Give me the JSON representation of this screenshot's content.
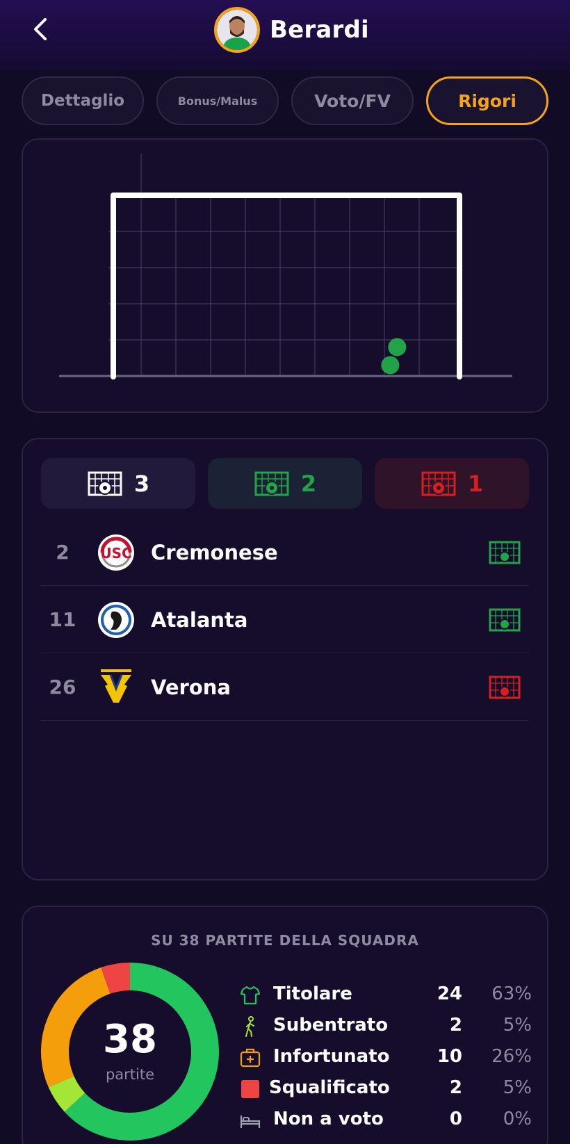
{
  "header": {
    "title": "Berardi"
  },
  "tabs": [
    {
      "label": "Dettaglio",
      "active": false
    },
    {
      "label": "Bonus/Malus",
      "active": false
    },
    {
      "label": "Voto/FV",
      "active": false
    },
    {
      "label": "Rigori",
      "active": true
    }
  ],
  "penalty_map": {
    "shots": [
      {
        "col": 8.2,
        "row": 4.2,
        "result": "goal"
      },
      {
        "col": 8.0,
        "row": 4.7,
        "result": "goal"
      }
    ]
  },
  "summary": {
    "total": "3",
    "scored": "2",
    "missed": "1"
  },
  "penalties": [
    {
      "matchday": "2",
      "team": "Cremonese",
      "result": "goal"
    },
    {
      "matchday": "11",
      "team": "Atalanta",
      "result": "goal"
    },
    {
      "matchday": "26",
      "team": "Verona",
      "result": "miss"
    }
  ],
  "squad": {
    "title": "SU 38 PARTITE DELLA SQUADRA",
    "total": "38",
    "total_label": "partite",
    "rows": [
      {
        "label": "Titolare",
        "count": "24",
        "pct": "63%",
        "icon": "shirt-icon",
        "color": "#22c55e"
      },
      {
        "label": "Subentrato",
        "count": "2",
        "pct": "5%",
        "icon": "walking-icon",
        "color": "#a3e635"
      },
      {
        "label": "Infortunato",
        "count": "10",
        "pct": "26%",
        "icon": "medkit-icon",
        "color": "#f59e0b"
      },
      {
        "label": "Squalificato",
        "count": "2",
        "pct": "5%",
        "icon": "red-card-icon",
        "color": "#ef4444"
      },
      {
        "label": "Non a voto",
        "count": "0",
        "pct": "0%",
        "icon": "bed-icon",
        "color": "#9ca3af"
      }
    ]
  },
  "colors": {
    "accent": "#f6a417",
    "goal": "#22a347",
    "miss": "#d81e1e"
  }
}
